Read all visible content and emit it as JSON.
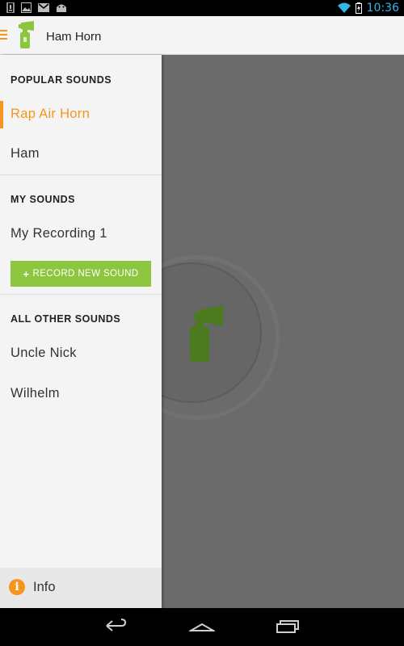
{
  "status_bar": {
    "left_icons": [
      "download-icon",
      "image-icon",
      "gmail-icon",
      "android-icon"
    ],
    "time": "10:36",
    "time_color": "#33b5e5"
  },
  "action_bar": {
    "title": "Ham Horn",
    "menu_icon": "hamburger-icon",
    "logo_icon": "air-horn-logo-icon"
  },
  "drawer": {
    "popular": {
      "header": "POPULAR SOUNDS",
      "items": [
        {
          "label": "Rap Air Horn",
          "active": true
        },
        {
          "label": "Ham",
          "active": false
        }
      ]
    },
    "my_sounds": {
      "header": "MY SOUNDS",
      "items": [
        {
          "label": "My Recording 1"
        }
      ],
      "record_button": "RECORD NEW SOUND"
    },
    "all_other": {
      "header": "ALL OTHER SOUNDS",
      "items": [
        {
          "label": "Uncle Nick"
        },
        {
          "label": "Wilhelm"
        }
      ]
    },
    "info": {
      "label": "Info",
      "icon": "info-icon"
    }
  },
  "main": {
    "horn_icon": "air-horn-icon"
  },
  "colors": {
    "accent": "#f7941d",
    "record_button": "#8cc63f",
    "horn_green": "#4c7a1e"
  },
  "nav_bar": {
    "buttons": [
      "back-icon",
      "home-icon",
      "recent-apps-icon"
    ]
  }
}
